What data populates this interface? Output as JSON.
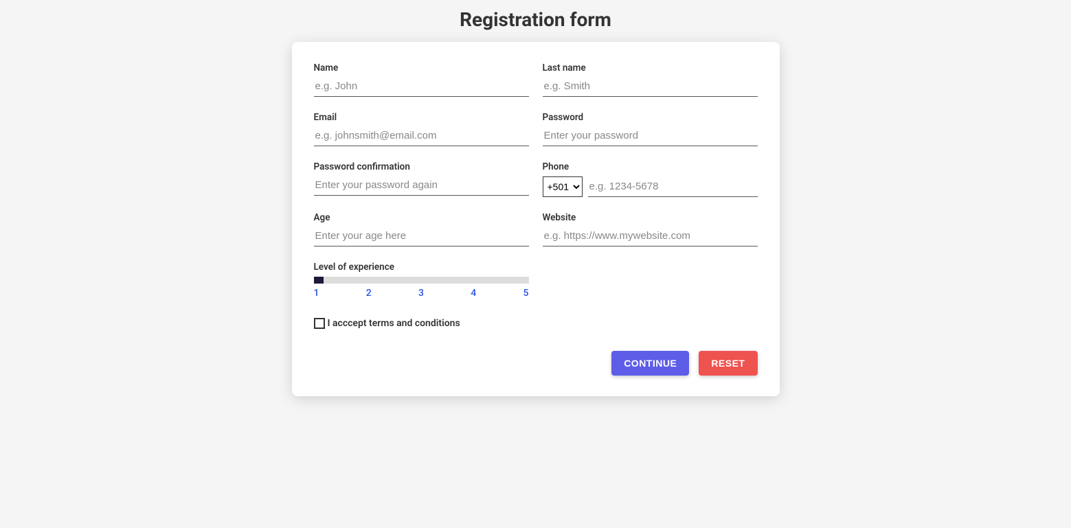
{
  "title": "Registration form",
  "fields": {
    "name": {
      "label": "Name",
      "placeholder": "e.g. John"
    },
    "lastname": {
      "label": "Last name",
      "placeholder": "e.g. Smith"
    },
    "email": {
      "label": "Email",
      "placeholder": "e.g. johnsmith@email.com"
    },
    "password": {
      "label": "Password",
      "placeholder": "Enter your password"
    },
    "password_confirm": {
      "label": "Password confirmation",
      "placeholder": "Enter your password again"
    },
    "phone": {
      "label": "Phone",
      "code": "+501",
      "placeholder": "e.g. 1234-5678"
    },
    "age": {
      "label": "Age",
      "placeholder": "Enter your age here"
    },
    "website": {
      "label": "Website",
      "placeholder": "e.g. https://www.mywebsite.com"
    },
    "experience": {
      "label": "Level of experience",
      "ticks": [
        "1",
        "2",
        "3",
        "4",
        "5"
      ]
    },
    "terms": {
      "label": "I acccept terms and conditions",
      "checked": false
    }
  },
  "buttons": {
    "continue": "CONTINUE",
    "reset": "RESET"
  }
}
